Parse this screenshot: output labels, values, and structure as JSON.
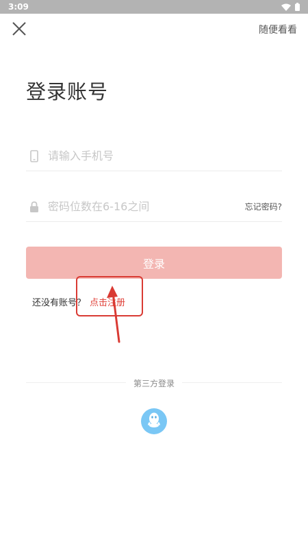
{
  "status_bar": {
    "time": "3:09"
  },
  "header": {
    "close_icon": "close-icon",
    "browse_label": "随便看看"
  },
  "title": "登录账号",
  "form": {
    "phone": {
      "placeholder": "请输入手机号",
      "value": "",
      "icon": "phone-icon"
    },
    "password": {
      "placeholder": "密码位数在6-16之间",
      "value": "",
      "icon": "lock-icon",
      "forgot_label": "忘记密码?"
    },
    "login_label": "登录"
  },
  "register": {
    "prompt": "还没有账号？",
    "link_label": "点击注册"
  },
  "third_party": {
    "label": "第三方登录",
    "providers": [
      {
        "icon": "qq-icon"
      }
    ]
  },
  "colors": {
    "accent": "#e0423a",
    "login_button": "#f3b6b2",
    "qq_button": "#7ac7f5",
    "status_bar": "#b3b3b3",
    "annotation": "#d93a33"
  }
}
